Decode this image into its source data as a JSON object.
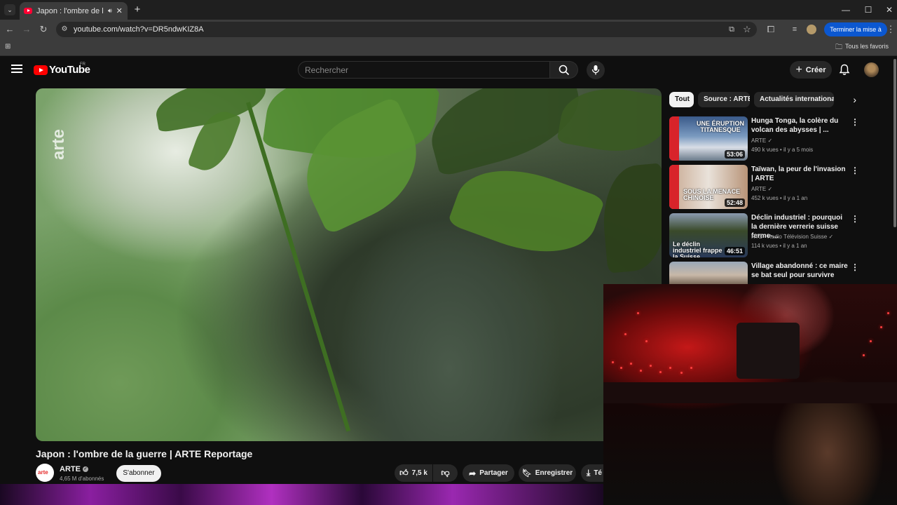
{
  "browser": {
    "tab_title": "Japon : l'ombre de la guerre",
    "url": "youtube.com/watch?v=DR5ndwKIZ8A",
    "update_button": "Terminer la mise à jour",
    "bookmarks_all": "Tous les favoris"
  },
  "header": {
    "logo_text": "YouTube",
    "country": "FR",
    "search_placeholder": "Rechercher",
    "create_label": "Créer"
  },
  "video": {
    "watermark": "arte",
    "title": "Japon : l'ombre de la guerre | ARTE Reportage",
    "channel_logo": "arte",
    "channel": "ARTE",
    "subscribers": "4,65 M d'abonnés",
    "subscribe_label": "S'abonner",
    "likes": "7,5 k",
    "share_label": "Partager",
    "save_label": "Enregistrer",
    "download_label": "Té"
  },
  "chips": [
    "Tout",
    "Source : ARTE",
    "Actualités internationales"
  ],
  "recommendations": [
    {
      "title": "Hunga Tonga, la colère du volcan des abysses | ...",
      "channel": "ARTE",
      "meta": "490 k vues • il y a 5 mois",
      "duration": "53:06",
      "thumb_text": "UNE ÉRUPTION TITANESQUE"
    },
    {
      "title": "Taïwan, la peur de l'invasion | ARTE",
      "channel": "ARTE",
      "meta": "452 k vues • il y a 1 an",
      "duration": "52:48",
      "thumb_text": "SOUS LA MENACE CHINOISE"
    },
    {
      "title": "Déclin industriel : pourquoi la dernière verrerie suisse ferme-...",
      "channel": "RTS - Radio Télévision Suisse",
      "meta": "114 k vues • il y a 1 an",
      "duration": "46:51",
      "thumb_text": "Le déclin industriel frappe la Suisse"
    },
    {
      "title": "Village abandonné : ce maire se bat seul pour survivre",
      "channel": "",
      "meta": "",
      "duration": "",
      "thumb_text": ""
    }
  ],
  "colors": {
    "accent_red": "#ff0000",
    "update_blue": "#0b57d0",
    "bg": "#0f0f0f"
  }
}
